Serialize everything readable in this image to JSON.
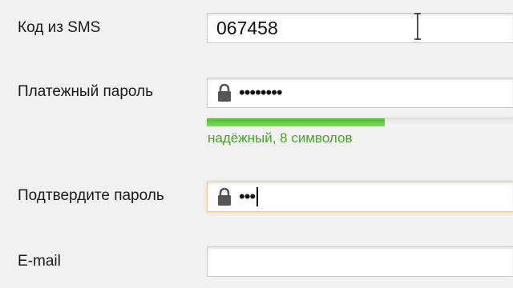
{
  "fields": {
    "sms": {
      "label": "Код из SMS",
      "value": "067458"
    },
    "payment_password": {
      "label": "Платежный пароль",
      "masked_value": "••••••••",
      "icon": "lock-icon"
    },
    "strength": {
      "level": 0.58,
      "text": "надёжный, 8 символов",
      "color": "#4cbb2c"
    },
    "confirm_password": {
      "label": "Подтвердите пароль",
      "masked_value": "•••",
      "icon": "lock-icon",
      "focused": true
    },
    "email": {
      "label": "E-mail",
      "value": ""
    }
  }
}
